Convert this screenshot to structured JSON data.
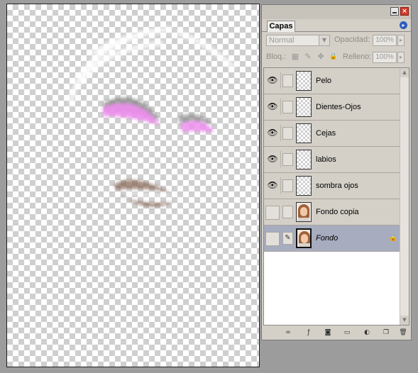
{
  "panel": {
    "tab_label": "Capas",
    "blend_mode": "Normal",
    "opacity_label": "Opacidad:",
    "opacity_value": "100%",
    "lock_label": "Bloq.:",
    "fill_label": "Relleno:",
    "fill_value": "100%",
    "close_glyph": "×",
    "menu_glyph": "▸"
  },
  "layers": [
    {
      "name": "Pelo",
      "visible": true,
      "thumb": "transparent",
      "selected": false
    },
    {
      "name": "Dientes-Ojos",
      "visible": true,
      "thumb": "transparent",
      "selected": false
    },
    {
      "name": "Cejas",
      "visible": true,
      "thumb": "transparent",
      "selected": false
    },
    {
      "name": "labios",
      "visible": true,
      "thumb": "transparent",
      "selected": false
    },
    {
      "name": "sombra ojos",
      "visible": true,
      "thumb": "transparent",
      "selected": false
    },
    {
      "name": "Fondo copia",
      "visible": false,
      "thumb": "photo",
      "selected": false
    },
    {
      "name": "Fondo",
      "visible": false,
      "thumb": "photo",
      "selected": true,
      "locked": true
    }
  ],
  "icons": {
    "eye": "👁",
    "brush": "✎",
    "lock": "🔒",
    "scroll_up": "▲",
    "scroll_down": "▼",
    "lock_transparent": "▦",
    "lock_paint": "✎",
    "lock_move": "✥",
    "lock_all": "🔒"
  },
  "toolbar": [
    "link-layers-icon",
    "layer-style-icon",
    "layer-mask-icon",
    "new-group-icon",
    "adjustment-layer-icon",
    "new-layer-icon",
    "delete-layer-icon"
  ],
  "colors": {
    "eyeshadow": "#f08ef0",
    "lips": "#8a6a5a",
    "hair_highlight": "#ffffff",
    "selected_row": "#a8acbf"
  }
}
